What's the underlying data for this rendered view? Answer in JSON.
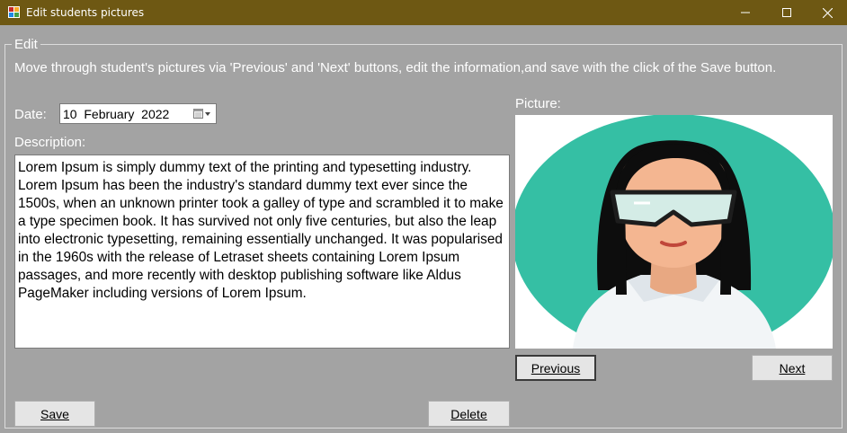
{
  "window": {
    "title": "Edit students pictures",
    "title_bar_color": "#6e5813"
  },
  "group": {
    "legend": "Edit",
    "instructions": "Move through student's pictures via 'Previous' and 'Next' buttons,  edit the information,and save with the click of the Save button."
  },
  "form": {
    "date_label": "Date:",
    "date_value": "10  February  2022",
    "description_label": "Description:",
    "description_text": "Lorem Ipsum is simply dummy text of the printing and typesetting industry. Lorem Ipsum has been the industry's standard dummy text ever since the 1500s, when an unknown printer took a galley of type and scrambled it to make a type specimen book. It has survived not only five centuries, but also the leap into electronic typesetting, remaining essentially unchanged. It was popularised in the 1960s with the release of Letraset sheets containing Lorem Ipsum passages, and more recently with desktop publishing software like Aldus PageMaker including versions of Lorem Ipsum.",
    "picture_label": "Picture:"
  },
  "buttons": {
    "previous": "Previous",
    "next": "Next",
    "save": "Save",
    "delete": "Delete"
  },
  "icons": {
    "app": "app-icon",
    "calendar": "calendar-dropdown-icon",
    "minimize": "minimize-icon",
    "maximize": "maximize-icon",
    "close": "close-icon"
  },
  "colors": {
    "background": "#a3a3a3",
    "avatar_circle": "#35bfa4",
    "skin": "#f4b691",
    "hair": "#0d0d0d",
    "goggles": "#d4ece6",
    "shirt": "#f2f5f7"
  }
}
